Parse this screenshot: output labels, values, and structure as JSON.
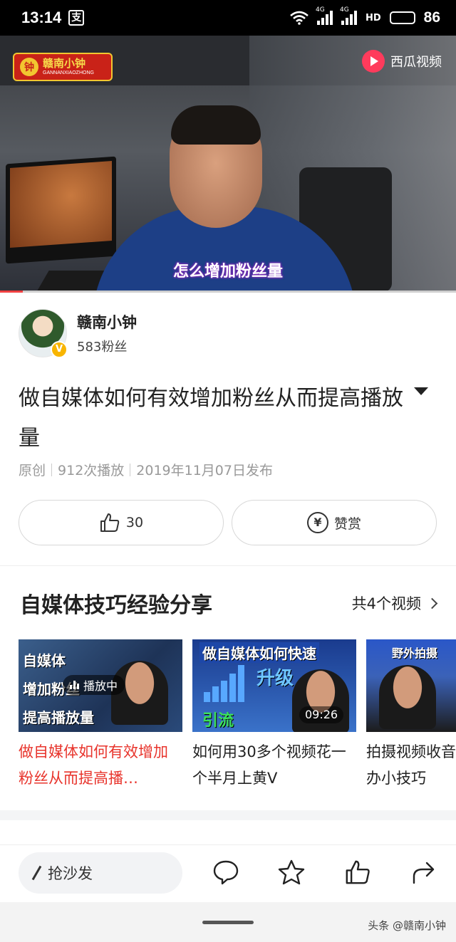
{
  "status_bar": {
    "time": "13:14",
    "app_icon": "支",
    "network_1": "4G",
    "network_2": "4G",
    "hd": "HD",
    "battery": "86"
  },
  "video": {
    "channel_logo_cn": "赣南小钟",
    "channel_logo_en": "GANNANXIAOZHONG",
    "platform": "西瓜视频",
    "subtitle": "怎么增加粉丝量",
    "progress_fraction": 0.05
  },
  "author": {
    "name": "赣南小钟",
    "fans": "583粉丝",
    "verified_mark": "V"
  },
  "article": {
    "title": "做自媒体如何有效增加粉丝从而提高播放量",
    "meta": [
      "原创",
      "912次播放",
      "2019年11月07日发布"
    ]
  },
  "actions": {
    "like_count": "30",
    "reward_label": "赞赏",
    "yen": "¥"
  },
  "collection": {
    "title": "自媒体技巧经验分享",
    "count_label": "共4个视频",
    "items": [
      {
        "title": "做自媒体如何有效增加粉丝从而提高播…",
        "badge": "播放中",
        "thumb_lines": [
          "自媒体",
          "增加粉丝",
          "提高播放量"
        ],
        "active": true
      },
      {
        "title": "如何用30多个视频花一个半月上黄V",
        "duration": "09:26",
        "thumb_lines": [
          "做自媒体如何快速",
          "升级",
          "引流"
        ]
      },
      {
        "title": "拍摄视频收音不好怎么办小技巧",
        "thumb_lines": [
          "野外拍摄"
        ]
      }
    ]
  },
  "bottom_bar": {
    "comment_placeholder": "抢沙发"
  },
  "watermark": "头条 @赣南小钟",
  "colors": {
    "accent_red": "#e8342c",
    "platform_pink": "#ff3b5c",
    "verified_gold": "#f8b500"
  }
}
